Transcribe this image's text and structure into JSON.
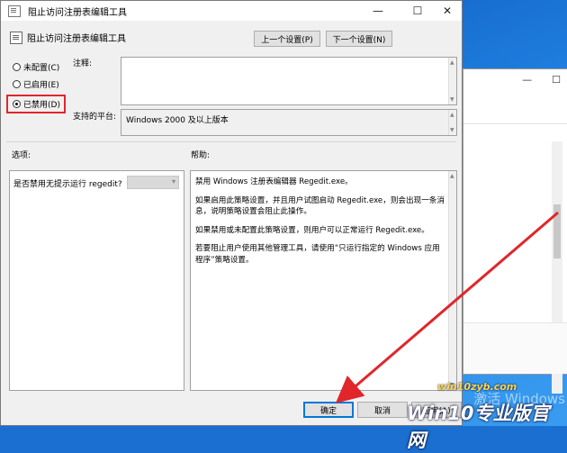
{
  "dialog": {
    "window_title": "阻止访问注册表编辑工具",
    "header_title": "阻止访问注册表编辑工具",
    "prev_setting": "上一个设置(P)",
    "next_setting": "下一个设置(N)",
    "radio_not_configured": "未配置(C)",
    "radio_enabled": "已启用(E)",
    "radio_disabled": "已禁用(D)",
    "selected_option": "已禁用(D)",
    "comment_label": "注释:",
    "comment_value": "",
    "supported_label": "支持的平台:",
    "supported_value": "Windows 2000 及以上版本",
    "options_label": "选项:",
    "help_label": "帮助:",
    "option_text": "是否禁用无提示运行 regedit?",
    "option_select_value": "",
    "help_paragraphs": [
      "禁用 Windows 注册表编辑器 Regedit.exe。",
      "如果启用此策略设置，并且用户试图启动 Regedit.exe，则会出现一条消息，说明策略设置会阻止此操作。",
      "如果禁用或未配置此策略设置，则用户可以正常运行 Regedit.exe。",
      "若要阻止用户使用其他管理工具，请使用“只运行指定的 Windows 应用程序”策略设置。"
    ],
    "ok_label": "确定",
    "cancel_label": "取消",
    "apply_label": "应用(A)",
    "minimize_glyph": "—",
    "maximize_glyph": "☐",
    "close_glyph": "✕"
  },
  "background_window": {
    "minimize_glyph": "—",
    "maximize_glyph": "☐"
  },
  "watermark": {
    "site": "win10zyb.com",
    "brand": "Win10专业版官网",
    "activate": "激活 Windows"
  },
  "colors": {
    "highlight_box": "#e0262b",
    "arrow": "#e0262b",
    "accent": "#0078d7"
  }
}
